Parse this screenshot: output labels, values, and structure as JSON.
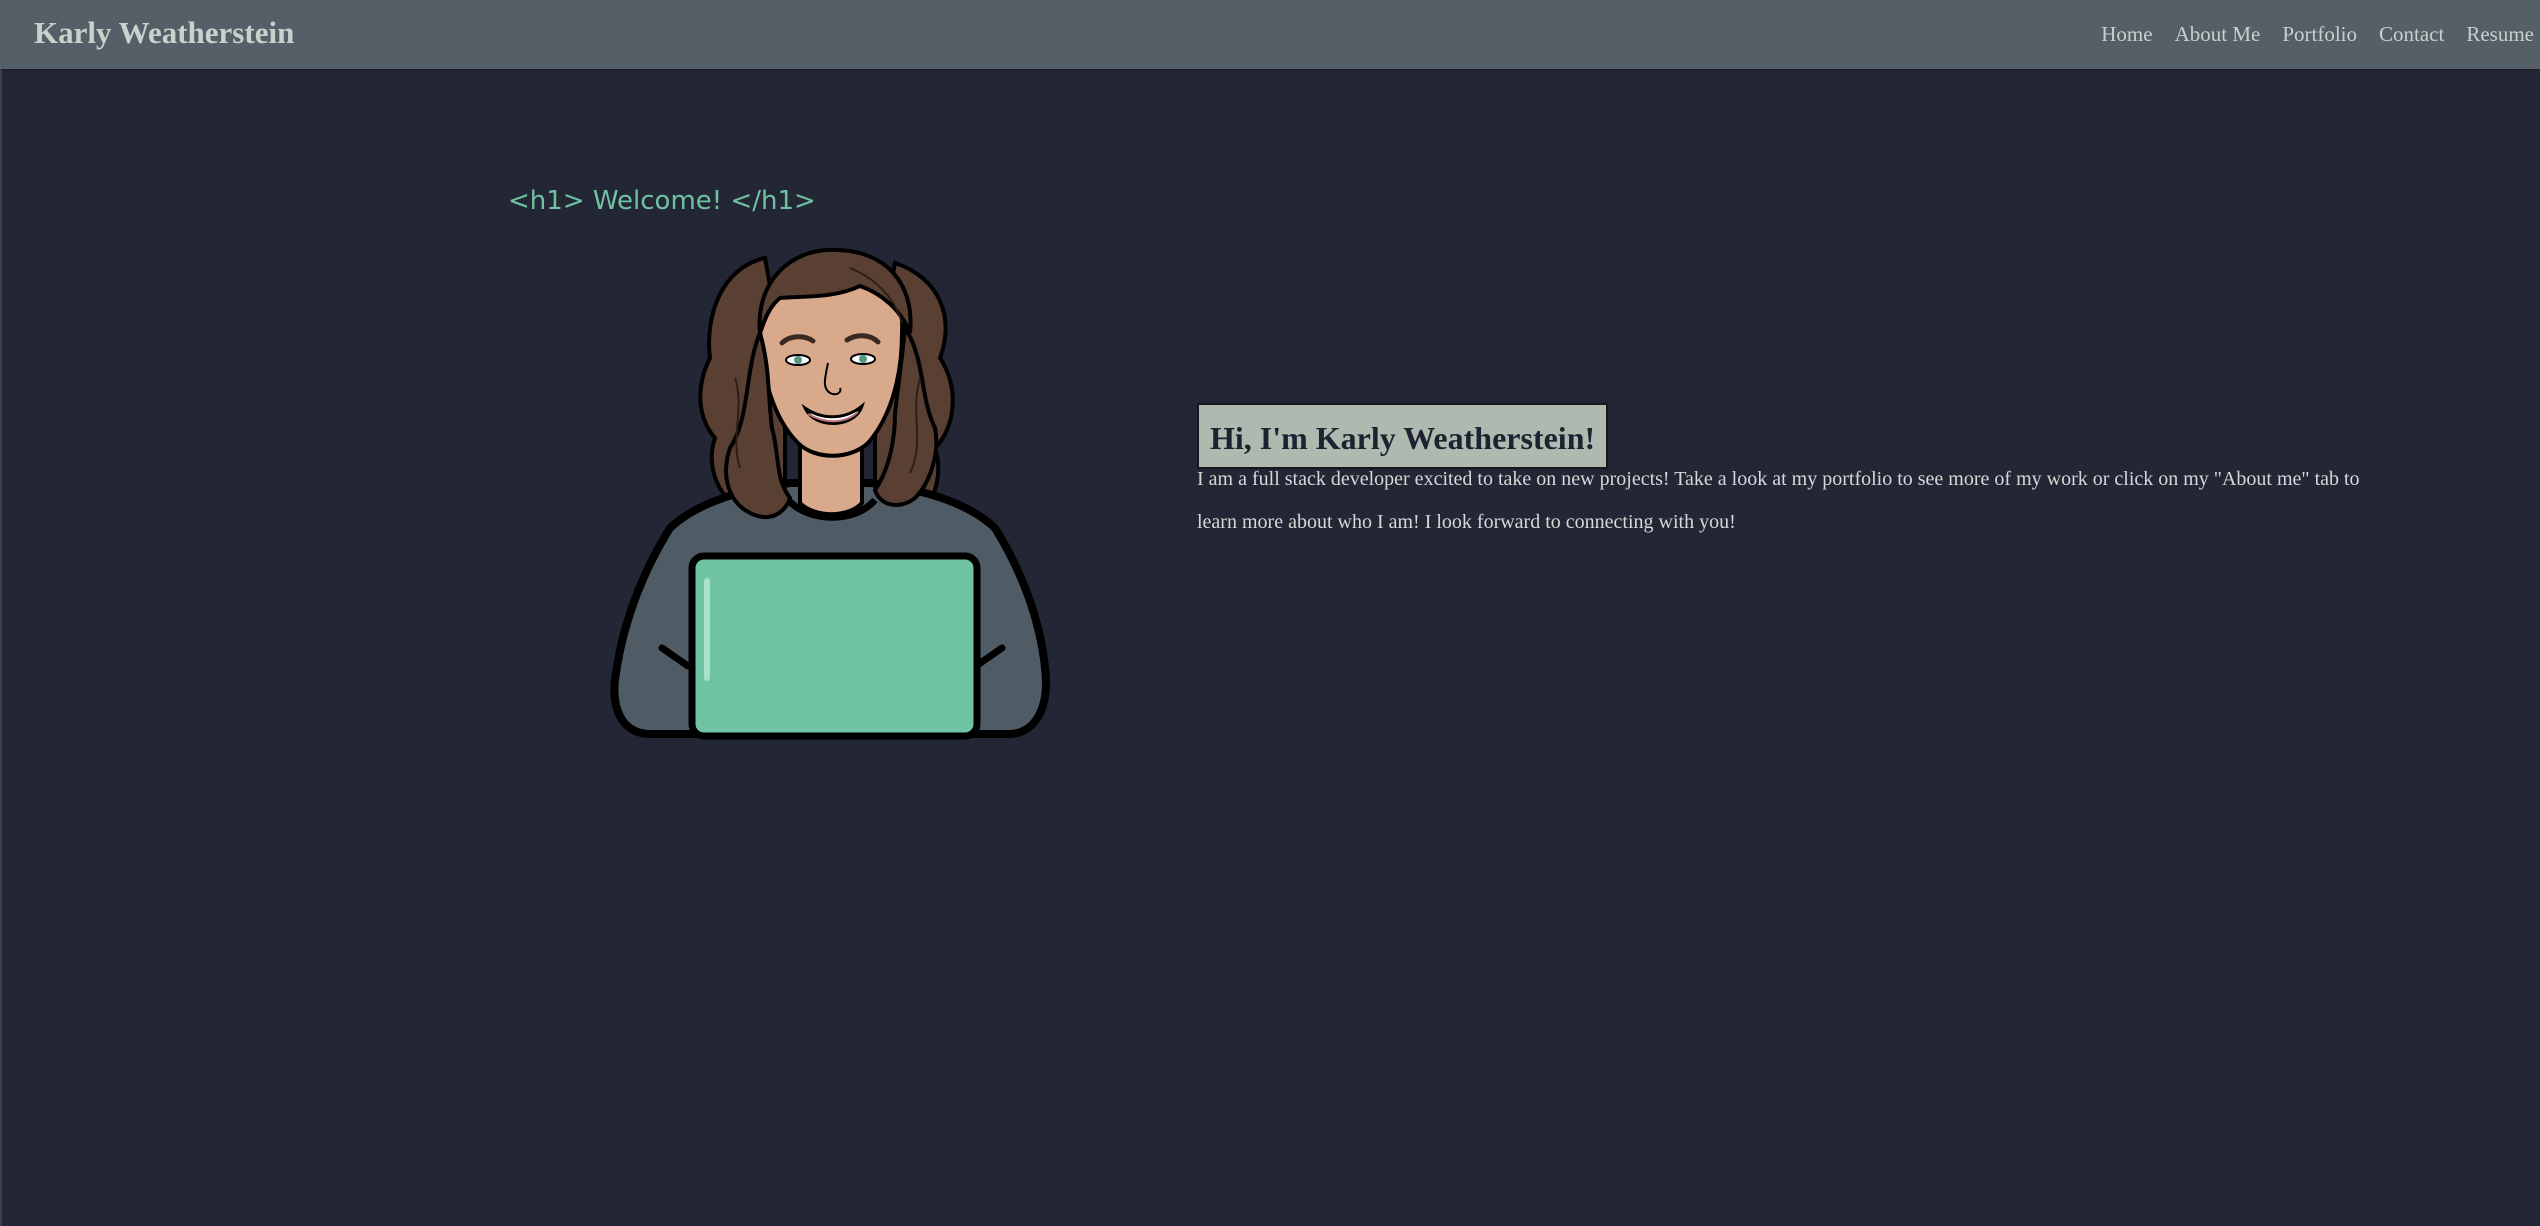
{
  "nav": {
    "brand": "Karly Weatherstein",
    "links": [
      "Home",
      "About Me",
      "Portfolio",
      "Contact",
      "Resume"
    ]
  },
  "hero": {
    "welcome_text": "<h1> Welcome! </h1>",
    "greeting": "Hi, I'm Karly Weatherstein!",
    "bio": "I am a full stack developer excited to take on new projects! Take a look at my portfolio to see more of my work or click on my \"About me\" tab to learn more about who I am! I look forward to connecting with you!",
    "avatar_icon": "person-with-laptop-illustration"
  },
  "colors": {
    "background": "#232634",
    "navbar": "#555f67",
    "accent_green": "#6fc1a2",
    "greeting_bg": "#aeb9b0"
  }
}
